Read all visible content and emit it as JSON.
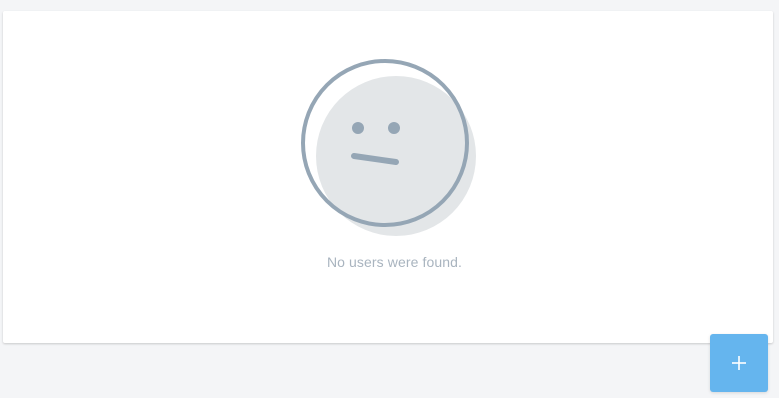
{
  "empty_state": {
    "message": "No users were found.",
    "illustration_icon": "neutral-face-icon"
  },
  "fab": {
    "icon": "plus-icon",
    "color": "#65b5ee"
  },
  "colors": {
    "background": "#f4f5f7",
    "panel": "#ffffff",
    "face_fill": "#e3e6e8",
    "face_stroke": "#95a6b5",
    "message_text": "#a9b4bf"
  }
}
